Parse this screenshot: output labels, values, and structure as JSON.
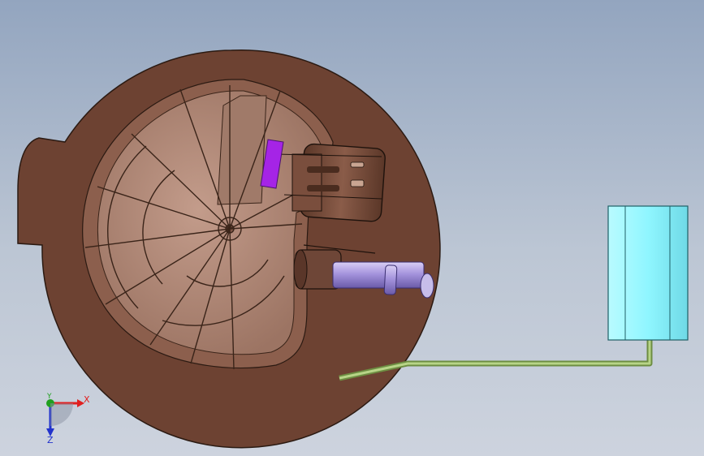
{
  "viewport": {
    "background_top": "#93a5bf",
    "background_bottom": "#cdd3de"
  },
  "model": {
    "housing_color": "#6d4232",
    "tray_color": "#b28a7a",
    "connector_color": "#6e4637",
    "connector_slot_color": "#a524e6",
    "pipe_color": "#9d8ad6",
    "sensor_color": "#8ff6ff",
    "wire_color": "#9ec06b"
  },
  "triad": {
    "x_label": "X",
    "y_label": "Y",
    "z_label": "Z",
    "x_color": "#e02020",
    "y_color": "#20a020",
    "z_color": "#2233cc"
  }
}
